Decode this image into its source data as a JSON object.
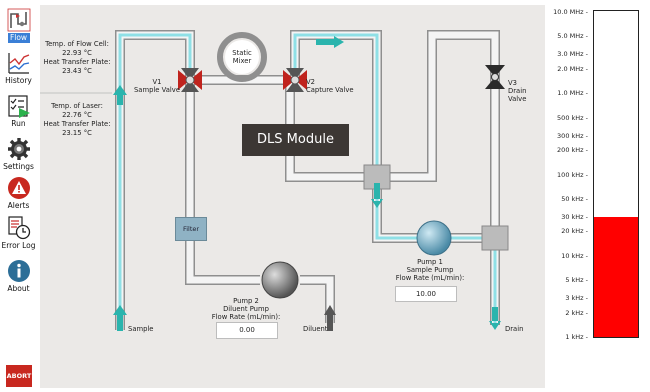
{
  "sidebar": {
    "items": [
      {
        "label": "Flow",
        "icon": "flow-icon",
        "active": true
      },
      {
        "label": "History",
        "icon": "history-chart-icon"
      },
      {
        "label": "Run",
        "icon": "run-checklist-icon"
      },
      {
        "label": "Settings",
        "icon": "gear-icon"
      },
      {
        "label": "Alerts",
        "icon": "alert-icon"
      },
      {
        "label": "Error Log",
        "icon": "error-log-icon"
      },
      {
        "label": "About",
        "icon": "info-icon"
      }
    ],
    "abort_label": "ABORT",
    "accent": "#3b7fd6",
    "abort_color": "#c8281f"
  },
  "temps": {
    "flow_cell_label": "Temp. of Flow Cell:",
    "flow_cell_value": "22.93 °C",
    "flow_cell_htp_label": "Heat Transfer Plate:",
    "flow_cell_htp_value": "23.43 °C",
    "laser_label": "Temp. of Laser:",
    "laser_value": "22.76 °C",
    "laser_htp_label": "Heat Transfer Plate:",
    "laser_htp_value": "23.15 °C"
  },
  "diagram": {
    "v1_id": "V1",
    "v1_name": "Sample Valve",
    "v2_id": "V2",
    "v2_name": "Capture Valve",
    "v3_id": "V3",
    "v3_name": "Drain Valve",
    "mixer_line1": "Static",
    "mixer_line2": "Mixer",
    "dls_module": "DLS Module",
    "filter": "Filter",
    "sample": "Sample",
    "diluent": "Diluent",
    "drain": "Drain",
    "pump1_line1": "Pump 1",
    "pump1_line2": "Sample Pump",
    "pump1_line3": "Flow Rate (mL/min):",
    "pump1_rate": "10.00",
    "pump2_line1": "Pump 2",
    "pump2_line2": "Diluent Pump",
    "pump2_line3": "Flow Rate (mL/min):",
    "pump2_rate": "0.00",
    "active_valve_color": "#c0231d",
    "flow_color": "#8fe0e6",
    "arrow_color": "#2ab4ad"
  },
  "gauge": {
    "ticks": [
      "10.0 MHz",
      "5.0 MHz",
      "3.0 MHz",
      "2.0 MHz",
      "1.0 MHz",
      "500 kHz",
      "300 kHz",
      "200 kHz",
      "100 kHz",
      "50 kHz",
      "30 kHz",
      "20 kHz",
      "10 kHz",
      "5 kHz",
      "3 kHz",
      "2 kHz",
      "1 kHz"
    ],
    "tick_hz": [
      10000000,
      5000000,
      3000000,
      2000000,
      1000000,
      500000,
      300000,
      200000,
      100000,
      50000,
      30000,
      20000,
      10000,
      5000,
      3000,
      2000,
      1000
    ],
    "min_hz": 1000,
    "max_hz": 10000000,
    "value_hz": 30000,
    "fill_color": "#ff0000"
  }
}
